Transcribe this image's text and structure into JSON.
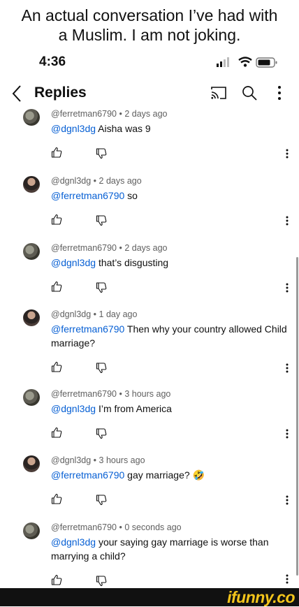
{
  "caption": {
    "line1": "An actual conversation I’ve had with",
    "line2": "a Muslim. I am not joking."
  },
  "status_bar": {
    "time": "4:36"
  },
  "header": {
    "title": "Replies",
    "icons": [
      "back-icon",
      "cast-icon",
      "search-icon",
      "more-icon"
    ]
  },
  "comments": [
    {
      "author": "@ferretman6790",
      "age": "2 days ago",
      "mention": "@dgnl3dg",
      "text": "Aisha was 9",
      "avatar": "a"
    },
    {
      "author": "@dgnl3dg",
      "age": "2 days ago",
      "mention": "@ferretman6790",
      "text": "so",
      "avatar": "b"
    },
    {
      "author": "@ferretman6790",
      "age": "2 days ago",
      "mention": "@dgnl3dg",
      "text": "that’s disgusting",
      "avatar": "a"
    },
    {
      "author": "@dgnl3dg",
      "age": "1 day ago",
      "mention": "@ferretman6790",
      "text": "Then why your country allowed Child marriage?",
      "avatar": "b"
    },
    {
      "author": "@ferretman6790",
      "age": "3 hours ago",
      "mention": "@dgnl3dg",
      "text": "I’m from America",
      "avatar": "a"
    },
    {
      "author": "@dgnl3dg",
      "age": "3 hours ago",
      "mention": "@ferretman6790",
      "text": "gay marriage? 🤣",
      "avatar": "b"
    },
    {
      "author": "@ferretman6790",
      "age": "0 seconds ago",
      "mention": "@dgnl3dg",
      "text": "your saying gay marriage is worse than marrying a child?",
      "avatar": "a"
    }
  ],
  "watermark": "ifunny.co",
  "colors": {
    "mention": "#065fd4",
    "meta": "#606060",
    "text": "#0f0f0f",
    "watermark": "#f4c51b"
  }
}
